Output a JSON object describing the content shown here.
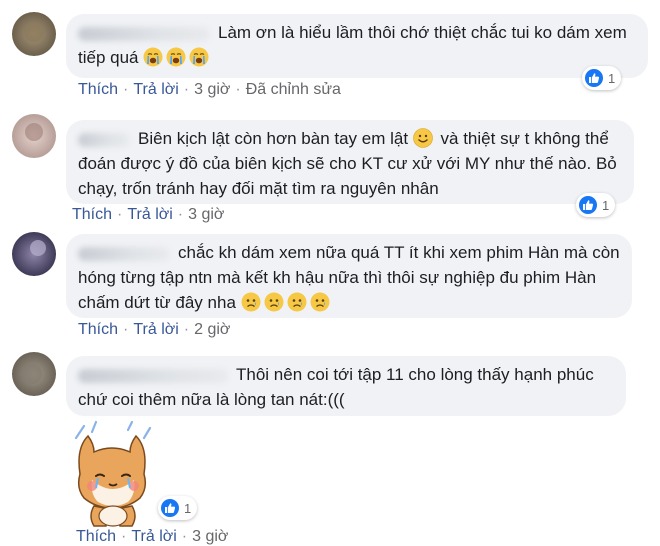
{
  "comments": [
    {
      "text": "Làm ơn là hiểu lầm thôi chớ thiệt chắc tui ko dám xem tiếp quá",
      "actions": {
        "like": "Thích",
        "reply": "Trả lời",
        "time": "3 giờ",
        "edited": "Đã chỉnh sửa"
      },
      "reaction_count": "1"
    },
    {
      "text_before": "Biên kịch lật còn hơn bàn tay em lật",
      "text_after": " và thiệt sự t không thể đoán được ý đồ của biên kịch sẽ cho KT cư xử với MY như thế nào. Bỏ chạy, trốn tránh hay đối mặt tìm ra nguyên nhân",
      "actions": {
        "like": "Thích",
        "reply": "Trả lời",
        "time": "3 giờ"
      },
      "reaction_count": "1"
    },
    {
      "text": "chắc kh dám xem nữa quá TT ít khi xem phim Hàn mà còn hóng từng tập ntn mà kết kh hậu nữa thì thôi sự nghiệp đu phim Hàn chấm dứt từ đây nha",
      "actions": {
        "like": "Thích",
        "reply": "Trả lời",
        "time": "2 giờ"
      }
    },
    {
      "text": "Thôi nên coi tới tập 11 cho lòng thấy hạnh phúc chứ coi thêm nữa là lòng tan nát:(((",
      "actions": {
        "like": "Thích",
        "reply": "Trả lời",
        "time": "3 giờ"
      },
      "reaction_count": "1"
    }
  ],
  "icons": {
    "like": "like-icon",
    "crying": "crying-face-emoji",
    "sad": "sad-face-emoji",
    "smile": "smiling-face-emoji",
    "sticker": "crying-dog-sticker"
  },
  "colors": {
    "bubble": "#f0f2f5",
    "link": "#385898",
    "meta": "#65676b",
    "like_blue": "#1877f2"
  }
}
